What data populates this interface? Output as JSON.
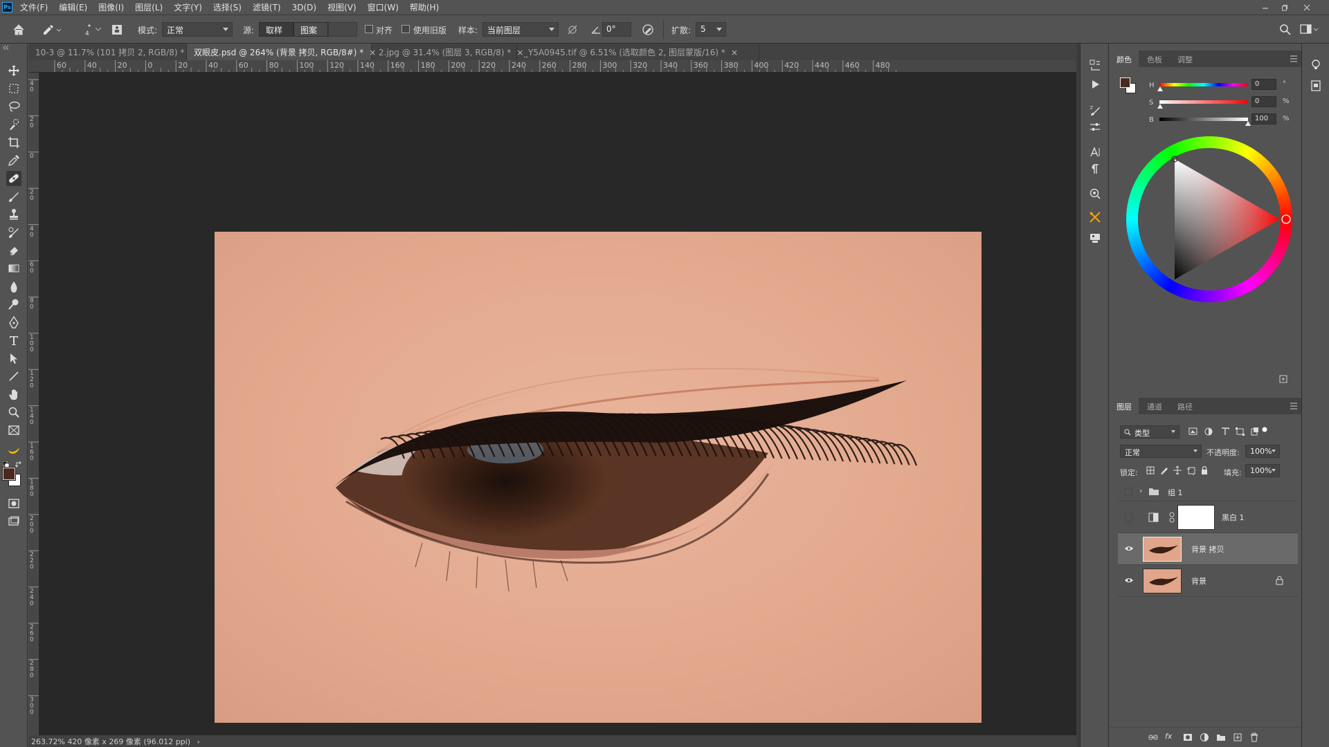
{
  "menu": {
    "app_icon": "Ps",
    "items": [
      "文件(F)",
      "编辑(E)",
      "图像(I)",
      "图层(L)",
      "文字(Y)",
      "选择(S)",
      "滤镜(T)",
      "3D(D)",
      "视图(V)",
      "窗口(W)",
      "帮助(H)"
    ]
  },
  "options": {
    "brush_size": "4",
    "mode_label": "模式:",
    "mode_value": "正常",
    "source_label": "源:",
    "source_sampled": "取样",
    "source_pattern": "图案",
    "aligned_label": "对齐",
    "legacy_label": "使用旧版",
    "sample_label": "样本:",
    "sample_value": "当前图层",
    "angle_value": "0°",
    "diffusion_label": "扩散:",
    "diffusion_value": "5"
  },
  "tabs": [
    {
      "label": "10-3 @ 11.7% (101 拷贝 2, RGB/8) *",
      "active": false
    },
    {
      "label": "双眼皮.psd @ 264% (背景 拷贝, RGB/8#) *",
      "active": true
    },
    {
      "label": "2.jpg @ 31.4% (图层 3, RGB/8) *",
      "active": false
    },
    {
      "label": "_Y5A0945.tif @ 6.51% (选取颜色 2, 图层蒙版/16) *",
      "active": false
    }
  ],
  "ruler": {
    "h_labels": [
      "60",
      "40",
      "20",
      "0",
      "20",
      "40",
      "60",
      "80",
      "100",
      "120",
      "140",
      "160",
      "180",
      "200",
      "220",
      "240",
      "260",
      "280",
      "300",
      "320",
      "340",
      "360",
      "380",
      "400",
      "420",
      "440",
      "460",
      "480"
    ],
    "v_labels": [
      "40",
      "20",
      "0",
      "20",
      "40",
      "60",
      "80",
      "100",
      "120",
      "140",
      "160",
      "180",
      "200",
      "220",
      "240",
      "260",
      "280",
      "300"
    ]
  },
  "status": {
    "text": "263.72%   420 像素 x 269 像素 (96.012 ppi)"
  },
  "color_panel": {
    "tabs": [
      "颜色",
      "色板",
      "调整"
    ],
    "h_label": "H",
    "h_value": "0",
    "h_unit": "°",
    "s_label": "S",
    "s_value": "0",
    "s_unit": "%",
    "b_label": "B",
    "b_value": "100",
    "b_unit": "%",
    "foreground": "#4a2a20",
    "background": "#ffffff"
  },
  "layers_panel": {
    "tabs": [
      "图层",
      "通道",
      "路径"
    ],
    "filter_label": "类型",
    "blend_mode": "正常",
    "opacity_label": "不透明度:",
    "opacity_value": "100%",
    "lock_label": "锁定:",
    "fill_label": "填充:",
    "fill_value": "100%",
    "layers": [
      {
        "name": "组 1",
        "type": "group",
        "visible": false
      },
      {
        "name": "黑白 1",
        "type": "adjustment",
        "visible": false
      },
      {
        "name": "背景 拷贝",
        "type": "pixel",
        "visible": true,
        "selected": true
      },
      {
        "name": "背景",
        "type": "pixel",
        "visible": true,
        "locked": true
      }
    ]
  },
  "colors": {
    "accent": "#31a8ff",
    "canvas_bg": "#282828",
    "ui_bg": "#535353",
    "skin": "#e3a98f",
    "tool_highlight": "#f4a200"
  }
}
